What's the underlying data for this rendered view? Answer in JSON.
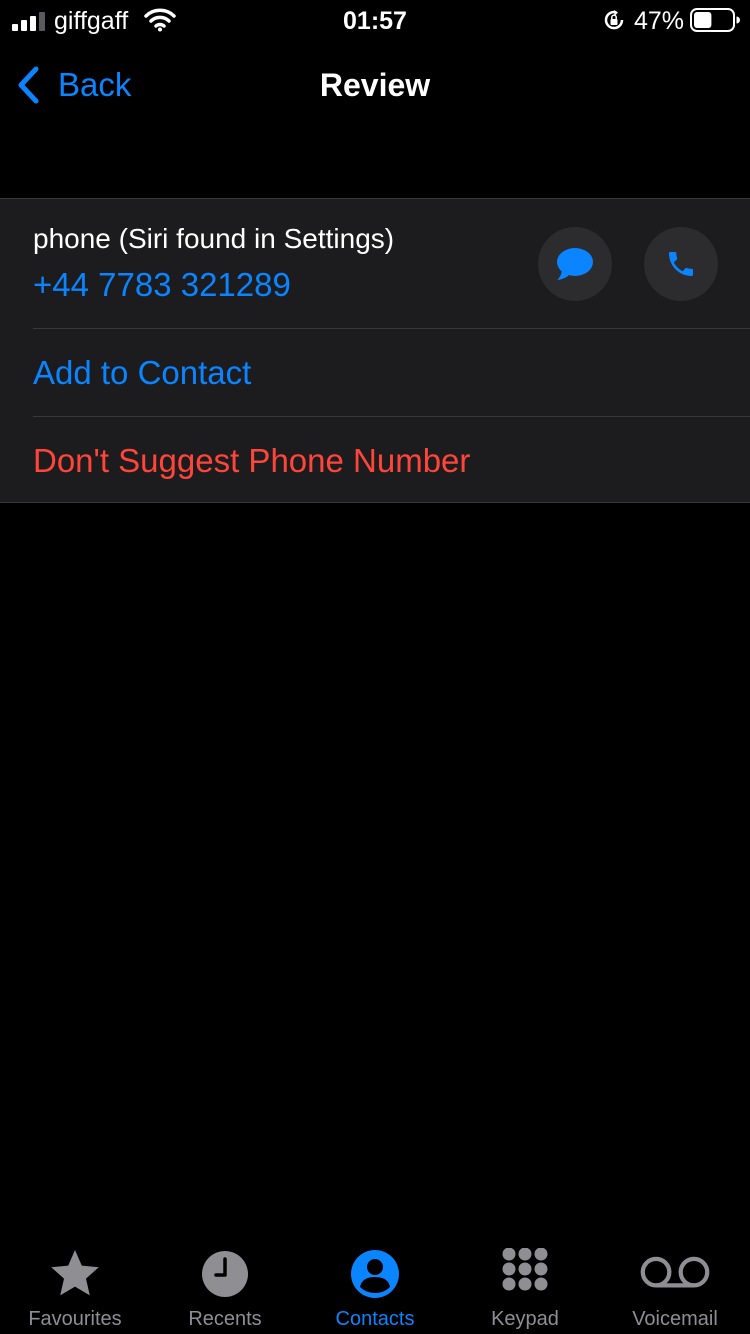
{
  "status_bar": {
    "carrier": "giffgaff",
    "time": "01:57",
    "battery_percent": "47%",
    "battery_level": 0.47
  },
  "nav": {
    "back_label": "Back",
    "title": "Review"
  },
  "suggestion": {
    "label": "phone (Siri found in Settings)",
    "number": "+44 7783 321289",
    "add_to_contact": "Add to Contact",
    "dont_suggest": "Don't Suggest Phone Number"
  },
  "tabs": [
    {
      "label": "Favourites",
      "icon": "star-icon",
      "active": false
    },
    {
      "label": "Recents",
      "icon": "clock-icon",
      "active": false
    },
    {
      "label": "Contacts",
      "icon": "person-circle-icon",
      "active": true
    },
    {
      "label": "Keypad",
      "icon": "keypad-icon",
      "active": false
    },
    {
      "label": "Voicemail",
      "icon": "voicemail-icon",
      "active": false
    }
  ],
  "colors": {
    "accent": "#0a84ff",
    "destructive": "#ff453a",
    "card_background": "#1c1c1e",
    "inactive_tab": "#8e8e93"
  }
}
